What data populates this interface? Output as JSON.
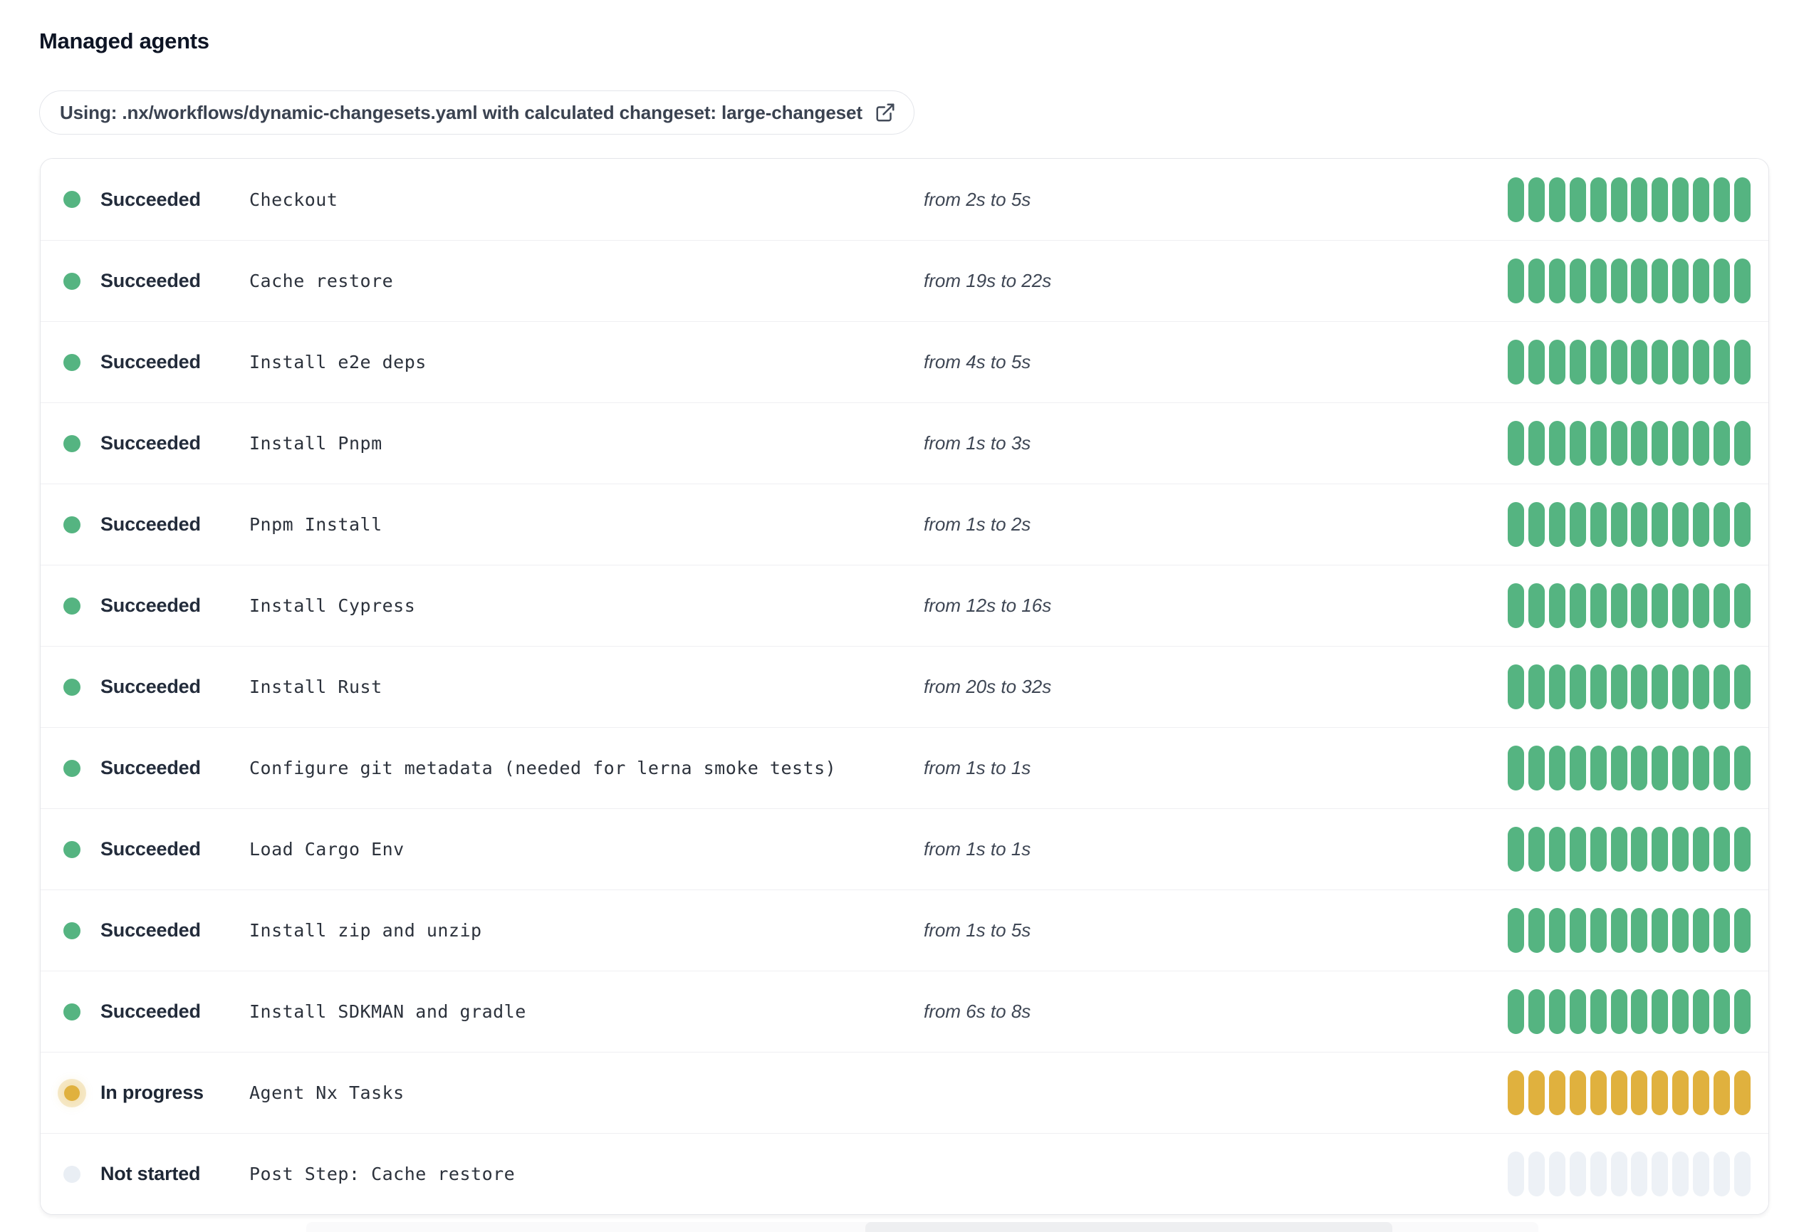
{
  "page": {
    "title": "Managed agents"
  },
  "banner": {
    "text": "Using: .nx/workflows/dynamic-changesets.yaml with calculated changeset: large-changeset",
    "icon": "external-link-icon"
  },
  "colors": {
    "succeeded": "#55b481",
    "in_progress": "#e0b13e",
    "not_started": "#edf1f6",
    "not_started_dot": "#e9eef4"
  },
  "agents_panel": {
    "pills_per_row": 12,
    "rows": [
      {
        "status": "Succeeded",
        "status_key": "succeeded",
        "name": "Checkout",
        "duration": "from 2s to 5s"
      },
      {
        "status": "Succeeded",
        "status_key": "succeeded",
        "name": "Cache restore",
        "duration": "from 19s to 22s"
      },
      {
        "status": "Succeeded",
        "status_key": "succeeded",
        "name": "Install e2e deps",
        "duration": "from 4s to 5s"
      },
      {
        "status": "Succeeded",
        "status_key": "succeeded",
        "name": "Install Pnpm",
        "duration": "from 1s to 3s"
      },
      {
        "status": "Succeeded",
        "status_key": "succeeded",
        "name": "Pnpm Install",
        "duration": "from 1s to 2s"
      },
      {
        "status": "Succeeded",
        "status_key": "succeeded",
        "name": "Install Cypress",
        "duration": "from 12s to 16s"
      },
      {
        "status": "Succeeded",
        "status_key": "succeeded",
        "name": "Install Rust",
        "duration": "from 20s to 32s"
      },
      {
        "status": "Succeeded",
        "status_key": "succeeded",
        "name": "Configure git metadata (needed for lerna smoke tests)",
        "duration": "from 1s to 1s"
      },
      {
        "status": "Succeeded",
        "status_key": "succeeded",
        "name": "Load Cargo Env",
        "duration": "from 1s to 1s"
      },
      {
        "status": "Succeeded",
        "status_key": "succeeded",
        "name": "Install zip and unzip",
        "duration": "from 1s to 5s"
      },
      {
        "status": "Succeeded",
        "status_key": "succeeded",
        "name": "Install SDKMAN and gradle",
        "duration": "from 6s to 8s"
      },
      {
        "status": "In progress",
        "status_key": "in_progress",
        "name": "Agent Nx Tasks",
        "duration": ""
      },
      {
        "status": "Not started",
        "status_key": "not_started",
        "name": "Post Step: Cache restore",
        "duration": ""
      }
    ]
  }
}
